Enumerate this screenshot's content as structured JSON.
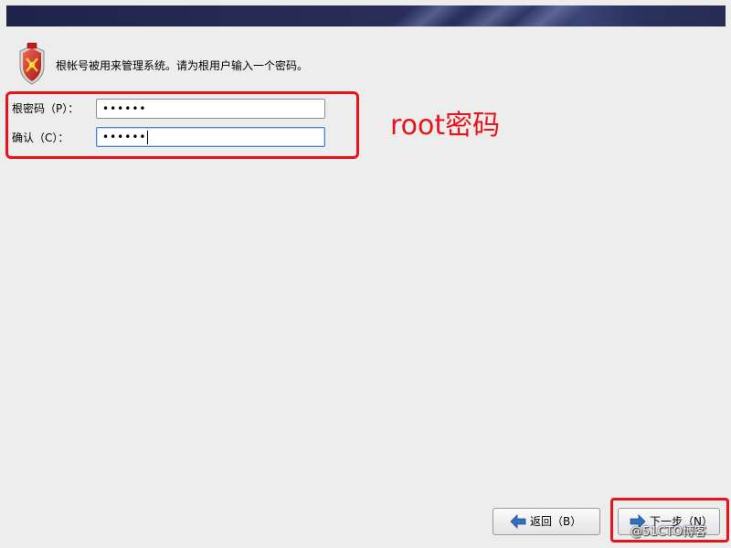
{
  "header": {
    "intro": "根帐号被用来管理系统。请为根用户输入一个密码。",
    "icon": "shield-crest-icon"
  },
  "form": {
    "root_password": {
      "label": "根密码（P）：",
      "value": "••••••"
    },
    "confirm": {
      "label": "确认（C）：",
      "value": "••••••"
    }
  },
  "annotation": {
    "text": "root密码",
    "color": "#e8141a"
  },
  "buttons": {
    "back": "返回（B）",
    "next": "下一步（N）"
  },
  "watermark": "@51CTO博客",
  "colors": {
    "banner": "#272d57",
    "highlight": "#e8141a",
    "arrow": "#2f6fc0"
  }
}
